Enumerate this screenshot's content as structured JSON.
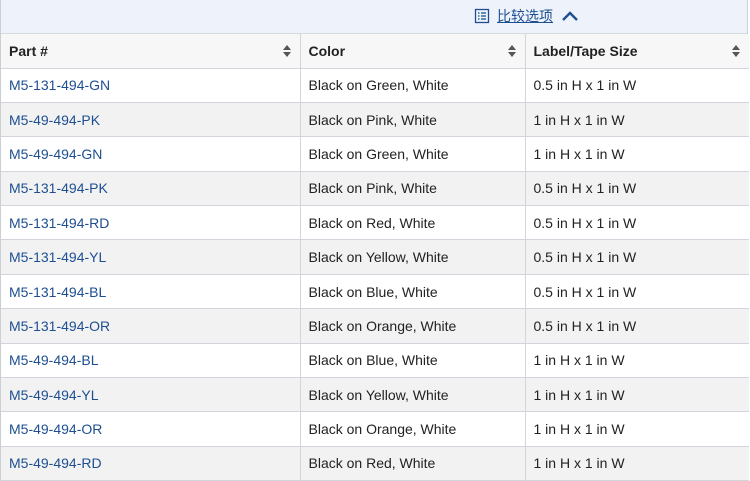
{
  "compare_bar": {
    "label": "比较选项",
    "icon": "list-icon",
    "toggle_icon": "chevron-up-icon"
  },
  "table": {
    "headers": [
      "Part #",
      "Color",
      "Label/Tape Size"
    ],
    "rows": [
      {
        "part": "M5-131-494-GN",
        "color": "Black on Green, White",
        "size": "0.5 in H x 1 in W"
      },
      {
        "part": "M5-49-494-PK",
        "color": "Black on Pink, White",
        "size": "1 in H x 1 in W"
      },
      {
        "part": "M5-49-494-GN",
        "color": "Black on Green, White",
        "size": "1 in H x 1 in W"
      },
      {
        "part": "M5-131-494-PK",
        "color": "Black on Pink, White",
        "size": "0.5 in H x 1 in W"
      },
      {
        "part": "M5-131-494-RD",
        "color": "Black on Red, White",
        "size": "0.5 in H x 1 in W"
      },
      {
        "part": "M5-131-494-YL",
        "color": "Black on Yellow, White",
        "size": "0.5 in H x 1 in W"
      },
      {
        "part": "M5-131-494-BL",
        "color": "Black on Blue, White",
        "size": "0.5 in H x 1 in W"
      },
      {
        "part": "M5-131-494-OR",
        "color": "Black on Orange, White",
        "size": "0.5 in H x 1 in W"
      },
      {
        "part": "M5-49-494-BL",
        "color": "Black on Blue, White",
        "size": "1 in H x 1 in W"
      },
      {
        "part": "M5-49-494-YL",
        "color": "Black on Yellow, White",
        "size": "1 in H x 1 in W"
      },
      {
        "part": "M5-49-494-OR",
        "color": "Black on Orange, White",
        "size": "1 in H x 1 in W"
      },
      {
        "part": "M5-49-494-RD",
        "color": "Black on Red, White",
        "size": "1 in H x 1 in W"
      }
    ]
  },
  "colors": {
    "link": "#1d4f91",
    "header_bg": "#f7f7f7",
    "stripe": "#f2f2f2",
    "compare_bg": "#eef3fb"
  }
}
